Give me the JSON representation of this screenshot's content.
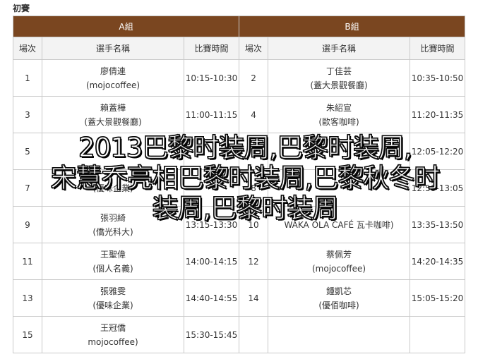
{
  "section": {
    "title": "初賽"
  },
  "groups": {
    "a": "A組",
    "b": "B組"
  },
  "columns": {
    "round": "場次",
    "player": "選手名稱",
    "time": "比賽時間"
  },
  "rows": [
    {
      "a": {
        "round": "1",
        "name": "廖倩連",
        "team": "(mojocoffee)",
        "time": "10:15-10:30"
      },
      "b": {
        "round": "2",
        "name": "丁佳芸",
        "team": "(蓋大景觀餐廳)",
        "time": "10:35-10:50"
      }
    },
    {
      "a": {
        "round": "3",
        "name": "賴蓋樺",
        "team": "(蓋大景觀餐廳)",
        "time": "11:00-11:15"
      },
      "b": {
        "round": "4",
        "name": "朱紹宣",
        "team": "(歐客咖啡)",
        "time": "11:20-11:35"
      }
    },
    {
      "a": {
        "round": "5",
        "name": "",
        "team": "",
        "time": ""
      },
      "b": {
        "round": "6",
        "name": "",
        "team": "",
        "time": "12:05-12:20"
      }
    },
    {
      "a": {
        "round": "7",
        "name": "",
        "team": "(優味企業)",
        "time": ""
      },
      "b": {
        "round": "8",
        "name": "",
        "team": "",
        "time": "12:50-13:05"
      }
    },
    {
      "a": {
        "round": "9",
        "name": "張羽綺",
        "team": "(僑光科大)",
        "time": "13:15-13:30"
      },
      "b": {
        "round": "10",
        "name": "",
        "team": "WAKA OLA CAFÉ 瓦卡咖啡)",
        "time": "13:35-13:50"
      }
    },
    {
      "a": {
        "round": "11",
        "name": "王聖偉",
        "team": "(個人名義)",
        "time": "14:00-14:15"
      },
      "b": {
        "round": "12",
        "name": "蔡佩芳",
        "team": "(mojocoffee)",
        "time": "14:20-14:35"
      }
    },
    {
      "a": {
        "round": "13",
        "name": "張雅雯",
        "team": "(優味企業)",
        "time": "14:40-14:55"
      },
      "b": {
        "round": "14",
        "name": "鍾凱芯",
        "team": "(優佰咖啡)",
        "time": "15:05-15:20"
      }
    },
    {
      "a": {
        "round": "15",
        "name": "王冠僑",
        "team": "mojocoffee)",
        "time": "15:30-15:45"
      },
      "b": {
        "round": "",
        "name": "",
        "team": "",
        "time": ""
      }
    }
  ],
  "overlay_text": {
    "line1": "2013巴黎时装周,巴黎时装周,",
    "line2": "宋慧乔亮相巴黎时装周,巴黎秋冬时",
    "line3": "装周,巴黎时装周"
  }
}
